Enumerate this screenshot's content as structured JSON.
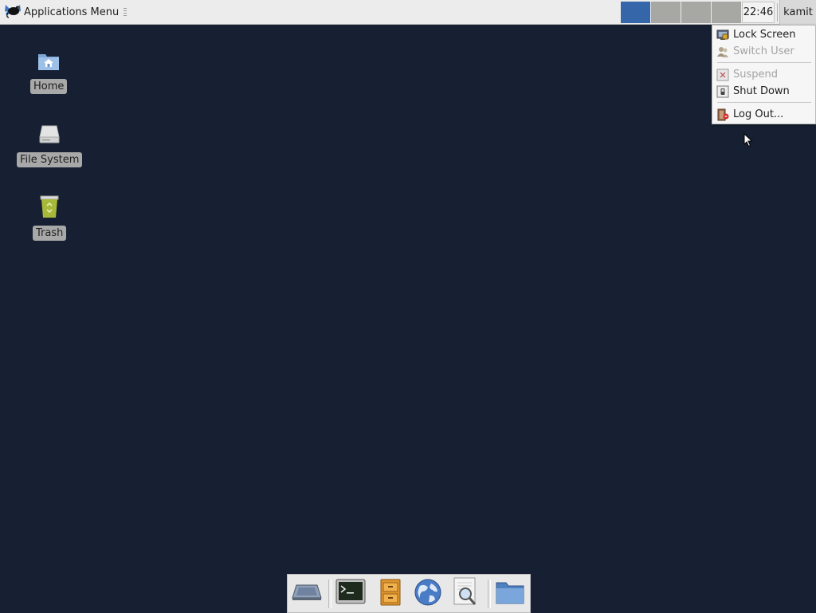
{
  "top_panel": {
    "app_menu_label": "Applications Menu",
    "workspaces": [
      {
        "name": "workspace-1",
        "active": true
      },
      {
        "name": "workspace-2",
        "active": false
      },
      {
        "name": "workspace-3",
        "active": false
      },
      {
        "name": "workspace-4",
        "active": false
      }
    ],
    "clock": "22:46",
    "user": "kamit"
  },
  "desktop": {
    "icons": [
      {
        "label": "Home",
        "icon": "home-folder-icon"
      },
      {
        "label": "File System",
        "icon": "drive-icon"
      },
      {
        "label": "Trash",
        "icon": "trash-icon"
      }
    ],
    "background_color": "#162032"
  },
  "session_menu": {
    "items": [
      {
        "label": "Lock Screen",
        "icon": "lock-screen-icon",
        "enabled": true
      },
      {
        "label": "Switch User",
        "icon": "switch-user-icon",
        "enabled": false
      },
      {
        "label": "Suspend",
        "icon": "suspend-icon",
        "enabled": false
      },
      {
        "label": "Shut Down",
        "icon": "shutdown-icon",
        "enabled": true
      },
      {
        "label": "Log Out...",
        "icon": "logout-icon",
        "enabled": true
      }
    ]
  },
  "dock": {
    "items": [
      {
        "name": "show-desktop",
        "icon": "show-desktop-icon"
      },
      {
        "name": "terminal",
        "icon": "terminal-icon"
      },
      {
        "name": "file-manager",
        "icon": "file-cabinet-icon"
      },
      {
        "name": "web-browser",
        "icon": "globe-icon"
      },
      {
        "name": "app-finder",
        "icon": "search-icon"
      },
      {
        "name": "folder",
        "icon": "folder-icon"
      }
    ]
  },
  "colors": {
    "panel": "#ececec",
    "active_workspace": "#3566aa",
    "inactive_workspace": "#a7a7a4"
  }
}
